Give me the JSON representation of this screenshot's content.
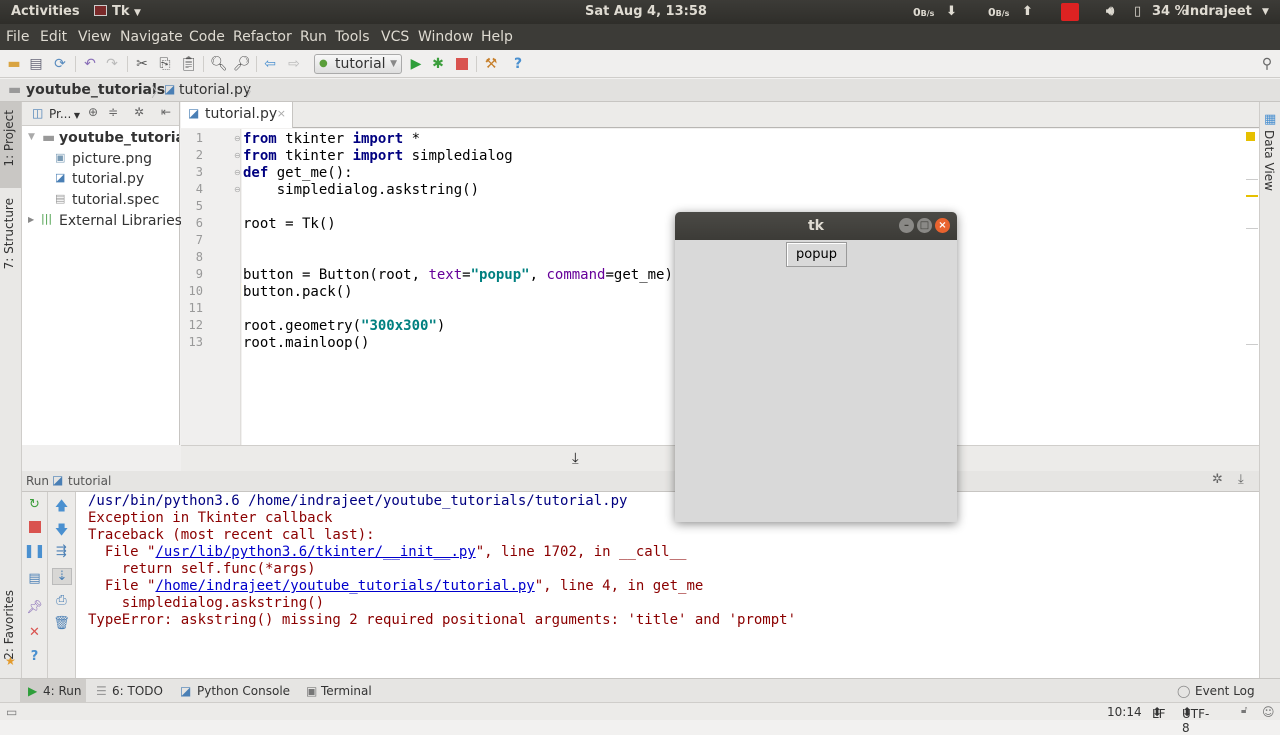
{
  "system_bar": {
    "activities": "Activities",
    "app_name": "Tk",
    "clock": "Sat Aug  4, 13:58",
    "net_down": "0",
    "net_down_unit": "B/s",
    "net_up": "0",
    "net_up_unit": "B/s",
    "battery": "34 %",
    "user": "Indrajeet"
  },
  "menu": [
    "File",
    "Edit",
    "View",
    "Navigate",
    "Code",
    "Refactor",
    "Run",
    "Tools",
    "VCS",
    "Window",
    "Help"
  ],
  "toolbar": {
    "run_config": "tutorial"
  },
  "breadcrumb": {
    "project": "youtube_tutorials",
    "file": "tutorial.py"
  },
  "left_strip": {
    "project_tab": "1: Project",
    "structure_tab": "7: Structure",
    "favorites_tab": "2: Favorites"
  },
  "right_strip": {
    "data_view_tab": "Data View"
  },
  "project_pane": {
    "header": "Pr...",
    "root": "youtube_tutorials",
    "files": [
      "picture.png",
      "tutorial.py",
      "tutorial.spec"
    ],
    "external": "External Libraries"
  },
  "editor": {
    "tab": "tutorial.py",
    "line_numbers": [
      "1",
      "2",
      "3",
      "4",
      "5",
      "6",
      "7",
      "8",
      "9",
      "10",
      "11",
      "12",
      "13"
    ],
    "current_line": 10,
    "lines": [
      [
        {
          "t": "from",
          "c": "kw"
        },
        {
          "t": " tkinter "
        },
        {
          "t": "import",
          "c": "kw"
        },
        {
          "t": " *"
        }
      ],
      [
        {
          "t": "from",
          "c": "kw"
        },
        {
          "t": " tkinter "
        },
        {
          "t": "import",
          "c": "kw"
        },
        {
          "t": " simpledialog"
        }
      ],
      [
        {
          "t": "def",
          "c": "kw"
        },
        {
          "t": " get_me():"
        }
      ],
      [
        {
          "t": "    simpledialog.askstring()"
        }
      ],
      [],
      [
        {
          "t": "root = Tk()"
        }
      ],
      [],
      [],
      [
        {
          "t": "button = Button(root, "
        },
        {
          "t": "text",
          "c": "kwarg"
        },
        {
          "t": "="
        },
        {
          "t": "\"popup\"",
          "c": "str"
        },
        {
          "t": ", "
        },
        {
          "t": "command",
          "c": "kwarg"
        },
        {
          "t": "=get_me)"
        }
      ],
      [
        {
          "t": "button.pack()"
        }
      ],
      [],
      [
        {
          "t": "root.geometry("
        },
        {
          "t": "\"300x300\"",
          "c": "str"
        },
        {
          "t": ")"
        }
      ],
      [
        {
          "t": "root.mainloop()"
        }
      ]
    ]
  },
  "run_panel": {
    "label": "Run",
    "config": "tutorial",
    "output": [
      {
        "type": "plain",
        "parts": [
          {
            "t": "/usr/bin/python3.6 /home/indrajeet/youtube_tutorials/tutorial.py"
          }
        ]
      },
      {
        "type": "err",
        "parts": [
          {
            "t": "Exception in Tkinter callback"
          }
        ]
      },
      {
        "type": "err",
        "parts": [
          {
            "t": "Traceback (most recent call last):"
          }
        ]
      },
      {
        "type": "err",
        "parts": [
          {
            "t": "  File \""
          },
          {
            "t": "/usr/lib/python3.6/tkinter/__init__.py",
            "link": true
          },
          {
            "t": "\", line 1702, in __call__"
          }
        ]
      },
      {
        "type": "err",
        "parts": [
          {
            "t": "    return self.func(*args)"
          }
        ]
      },
      {
        "type": "err",
        "parts": [
          {
            "t": "  File \""
          },
          {
            "t": "/home/indrajeet/youtube_tutorials/tutorial.py",
            "link": true
          },
          {
            "t": "\", line 4, in get_me"
          }
        ]
      },
      {
        "type": "err",
        "parts": [
          {
            "t": "    simpledialog.askstring()"
          }
        ]
      },
      {
        "type": "err",
        "parts": [
          {
            "t": "TypeError: askstring() missing 2 required positional arguments: 'title' and 'prompt'"
          }
        ]
      }
    ]
  },
  "bottom_tabs": {
    "run": "4: Run",
    "todo": "6: TODO",
    "python_console": "Python Console",
    "terminal": "Terminal",
    "event_log": "Event Log"
  },
  "status_bar": {
    "position": "10:14",
    "line_sep": "LF",
    "encoding": "UTF-8"
  },
  "tk_window": {
    "title": "tk",
    "button_label": "popup"
  },
  "colors": {
    "keyword": "#000080",
    "string": "#008080",
    "kwarg": "#660099",
    "error_text": "#8b0000",
    "link": "#0000cc",
    "caret_line": "#fdf9e8"
  }
}
